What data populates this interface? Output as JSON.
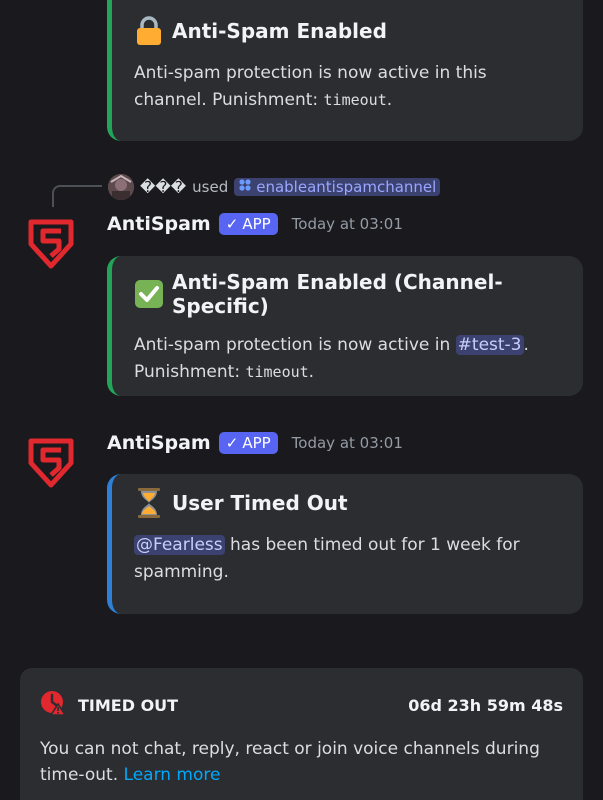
{
  "embed1": {
    "emoji": "🔒",
    "title": "Anti-Spam Enabled",
    "desc_line1": "Anti-spam protection is now active in this",
    "desc_prefix": "channel. Punishment: ",
    "desc_code": "timeout",
    "desc_suffix": "."
  },
  "reply": {
    "username": "���",
    "used": "used",
    "command": "enableantispamchannel"
  },
  "message2": {
    "author": "AntiSpam",
    "badge": "APP",
    "timestamp": "Today at 03:01",
    "embed": {
      "emoji": "✅",
      "title": "Anti-Spam Enabled (Channel-Specific)",
      "desc_prefix": "Anti-spam protection is now active in ",
      "channel": "#test-3",
      "desc_after_channel": ".",
      "desc_line2_prefix": "Punishment: ",
      "desc_code": "timeout",
      "desc_suffix": "."
    }
  },
  "message3": {
    "author": "AntiSpam",
    "badge": "APP",
    "timestamp": "Today at 03:01",
    "embed": {
      "emoji": "⏳",
      "title": "User Timed Out",
      "mention": "@Fearless",
      "desc_after_mention": " has been timed out for 1 week for",
      "desc_line2": "spamming."
    }
  },
  "timeout_notice": {
    "title": "TIMED OUT",
    "remaining": "06d 23h 59m 48s",
    "text": "You can not chat, reply, react or join voice channels during time-out. ",
    "link": "Learn more"
  },
  "colors": {
    "background": "#1a1a1e",
    "embed_bg": "#2b2d31",
    "embed_green": "#23a559",
    "embed_blue": "#2e7fd6",
    "app_badge": "#5865f2",
    "link": "#00a8fc",
    "logo_red": "#e0282e"
  },
  "icons": {
    "logo": "antispam-shield-logo",
    "checkmark": "checkmark-icon",
    "timeout": "clock-warning-icon",
    "command": "slash-command-icon"
  }
}
